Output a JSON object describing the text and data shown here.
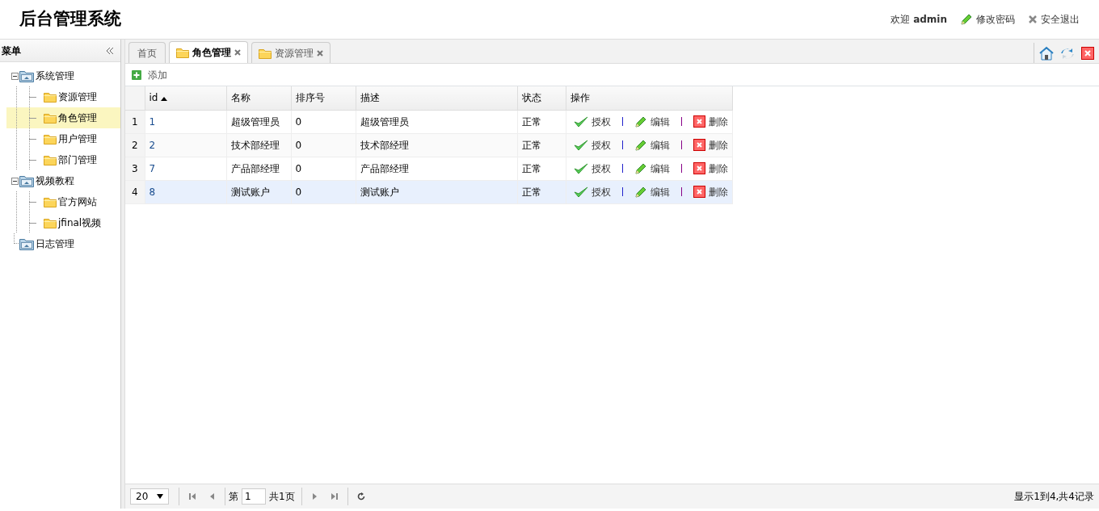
{
  "header": {
    "title": "后台管理系统",
    "welcome": "欢迎",
    "user": "admin",
    "actions": [
      {
        "label": "修改密码",
        "kind": "edit"
      },
      {
        "label": "安全退出",
        "kind": "logout"
      }
    ]
  },
  "sidebar": {
    "title": "菜单",
    "tree": [
      {
        "label": "系统管理",
        "expanded": true,
        "selected": false,
        "children": [
          {
            "label": "资源管理",
            "selected": false
          },
          {
            "label": "角色管理",
            "selected": true
          },
          {
            "label": "用户管理",
            "selected": false
          },
          {
            "label": "部门管理",
            "selected": false
          }
        ]
      },
      {
        "label": "视频教程",
        "expanded": true,
        "selected": false,
        "children": [
          {
            "label": "官方网站",
            "selected": false
          },
          {
            "label": "jfinal视频",
            "selected": false
          }
        ]
      },
      {
        "label": "日志管理",
        "selected": false
      }
    ]
  },
  "tabs": [
    {
      "label": "首页",
      "selected": false,
      "closable": false
    },
    {
      "label": "角色管理",
      "selected": true,
      "closable": true
    },
    {
      "label": "资源管理",
      "selected": false,
      "closable": true
    }
  ],
  "toolbar": {
    "add": "添加"
  },
  "table": {
    "columns": [
      {
        "label": "id",
        "sorted": true
      },
      {
        "label": "名称",
        "sorted": false
      },
      {
        "label": "排序号",
        "sorted": false
      },
      {
        "label": "描述",
        "sorted": false
      },
      {
        "label": "状态",
        "sorted": false
      },
      {
        "label": "操作",
        "sorted": false
      }
    ],
    "rows": [
      {
        "index": "1",
        "cells": [
          "1",
          "超级管理员",
          "0",
          "超级管理员",
          "正常"
        ],
        "selected": false,
        "actions": [
          {
            "label": "授权",
            "kind": "grant"
          },
          {
            "label": "编辑",
            "kind": "edit"
          },
          {
            "label": "删除",
            "kind": "delete"
          }
        ]
      },
      {
        "index": "2",
        "cells": [
          "2",
          "技术部经理",
          "0",
          "技术部经理",
          "正常"
        ],
        "selected": false,
        "actions": [
          {
            "label": "授权",
            "kind": "grant"
          },
          {
            "label": "编辑",
            "kind": "edit"
          },
          {
            "label": "删除",
            "kind": "delete"
          }
        ]
      },
      {
        "index": "3",
        "cells": [
          "7",
          "产品部经理",
          "0",
          "产品部经理",
          "正常"
        ],
        "selected": false,
        "actions": [
          {
            "label": "授权",
            "kind": "grant"
          },
          {
            "label": "编辑",
            "kind": "edit"
          },
          {
            "label": "删除",
            "kind": "delete"
          }
        ]
      },
      {
        "index": "4",
        "cells": [
          "8",
          "测试账户",
          "0",
          "测试账户",
          "正常"
        ],
        "selected": true,
        "actions": [
          {
            "label": "授权",
            "kind": "grant"
          },
          {
            "label": "编辑",
            "kind": "edit"
          },
          {
            "label": "删除",
            "kind": "delete"
          }
        ]
      }
    ]
  },
  "pager": {
    "page_size": "20",
    "page_prefix": "第",
    "page": "1",
    "page_suffix": "共1页",
    "summary": "显示1到4,共4记录"
  }
}
